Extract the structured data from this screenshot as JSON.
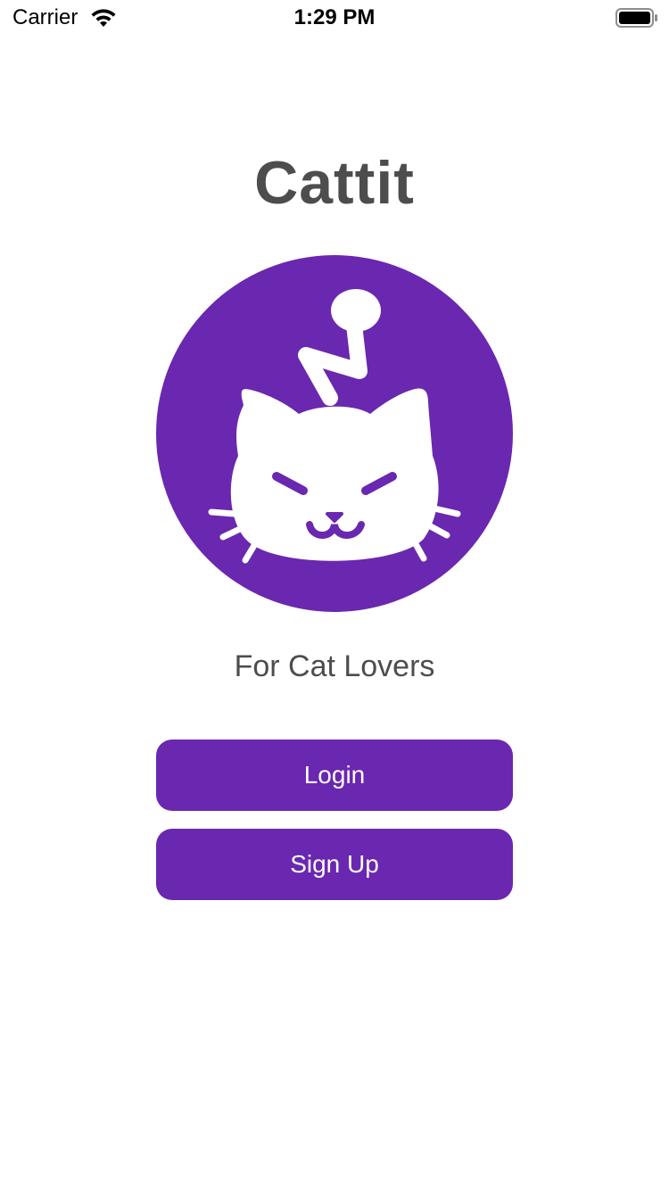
{
  "status_bar": {
    "carrier": "Carrier",
    "time": "1:29 PM"
  },
  "app": {
    "title": "Cattit",
    "tagline": "For Cat Lovers"
  },
  "buttons": {
    "login_label": "Login",
    "signup_label": "Sign Up"
  },
  "colors": {
    "brand_purple": "#6A27B0",
    "text_gray": "#4D4D4D",
    "background": "#FFFFFF"
  },
  "icons": {
    "logo": "cat-face-logo",
    "wifi": "wifi-icon",
    "battery": "battery-icon"
  }
}
